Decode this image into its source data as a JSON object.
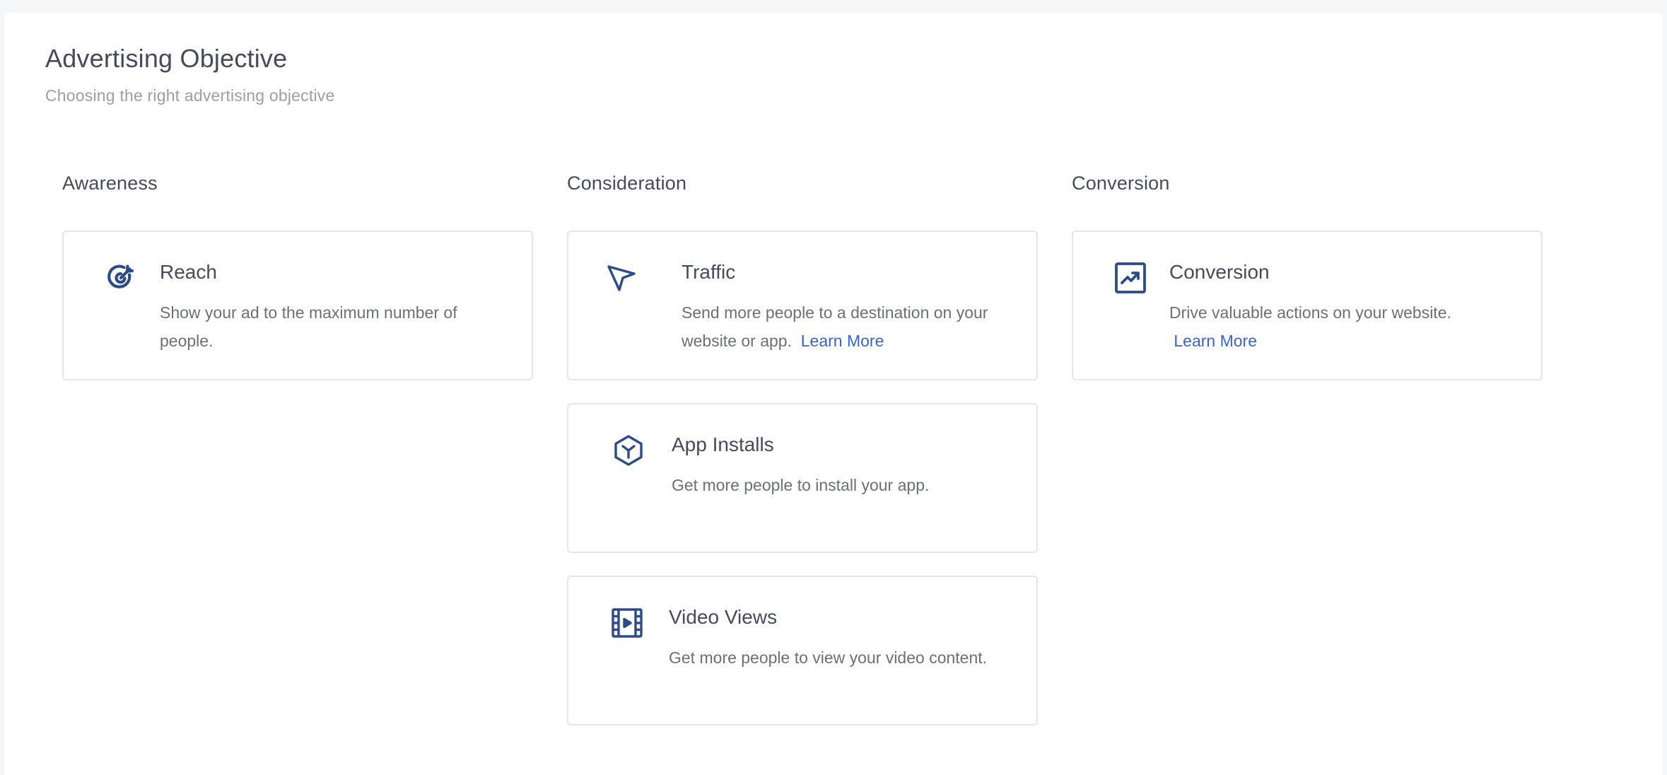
{
  "header": {
    "title": "Advertising Objective",
    "subtitle": "Choosing the right advertising objective"
  },
  "colors": {
    "icon": "#2d4a8a",
    "link": "#3a64c8",
    "heading": "#454a5c",
    "muted": "#9a9ea6"
  },
  "columns": [
    {
      "title": "Awareness",
      "cards": [
        {
          "icon": "target-icon",
          "title": "Reach",
          "description": "Show your ad to the maximum number of people."
        }
      ]
    },
    {
      "title": "Consideration",
      "cards": [
        {
          "icon": "cursor-arrow-icon",
          "title": "Traffic",
          "description": "Send more people to a destination on your website or app.",
          "link": "Learn More"
        },
        {
          "icon": "cube-icon",
          "title": "App Installs",
          "description": "Get more people to install your app."
        },
        {
          "icon": "film-icon",
          "title": "Video Views",
          "description": "Get more people to view your video content."
        }
      ]
    },
    {
      "title": "Conversion",
      "cards": [
        {
          "icon": "trending-chart-icon",
          "title": "Conversion",
          "description": "Drive valuable actions on your website.",
          "link": "Learn More"
        }
      ]
    }
  ]
}
